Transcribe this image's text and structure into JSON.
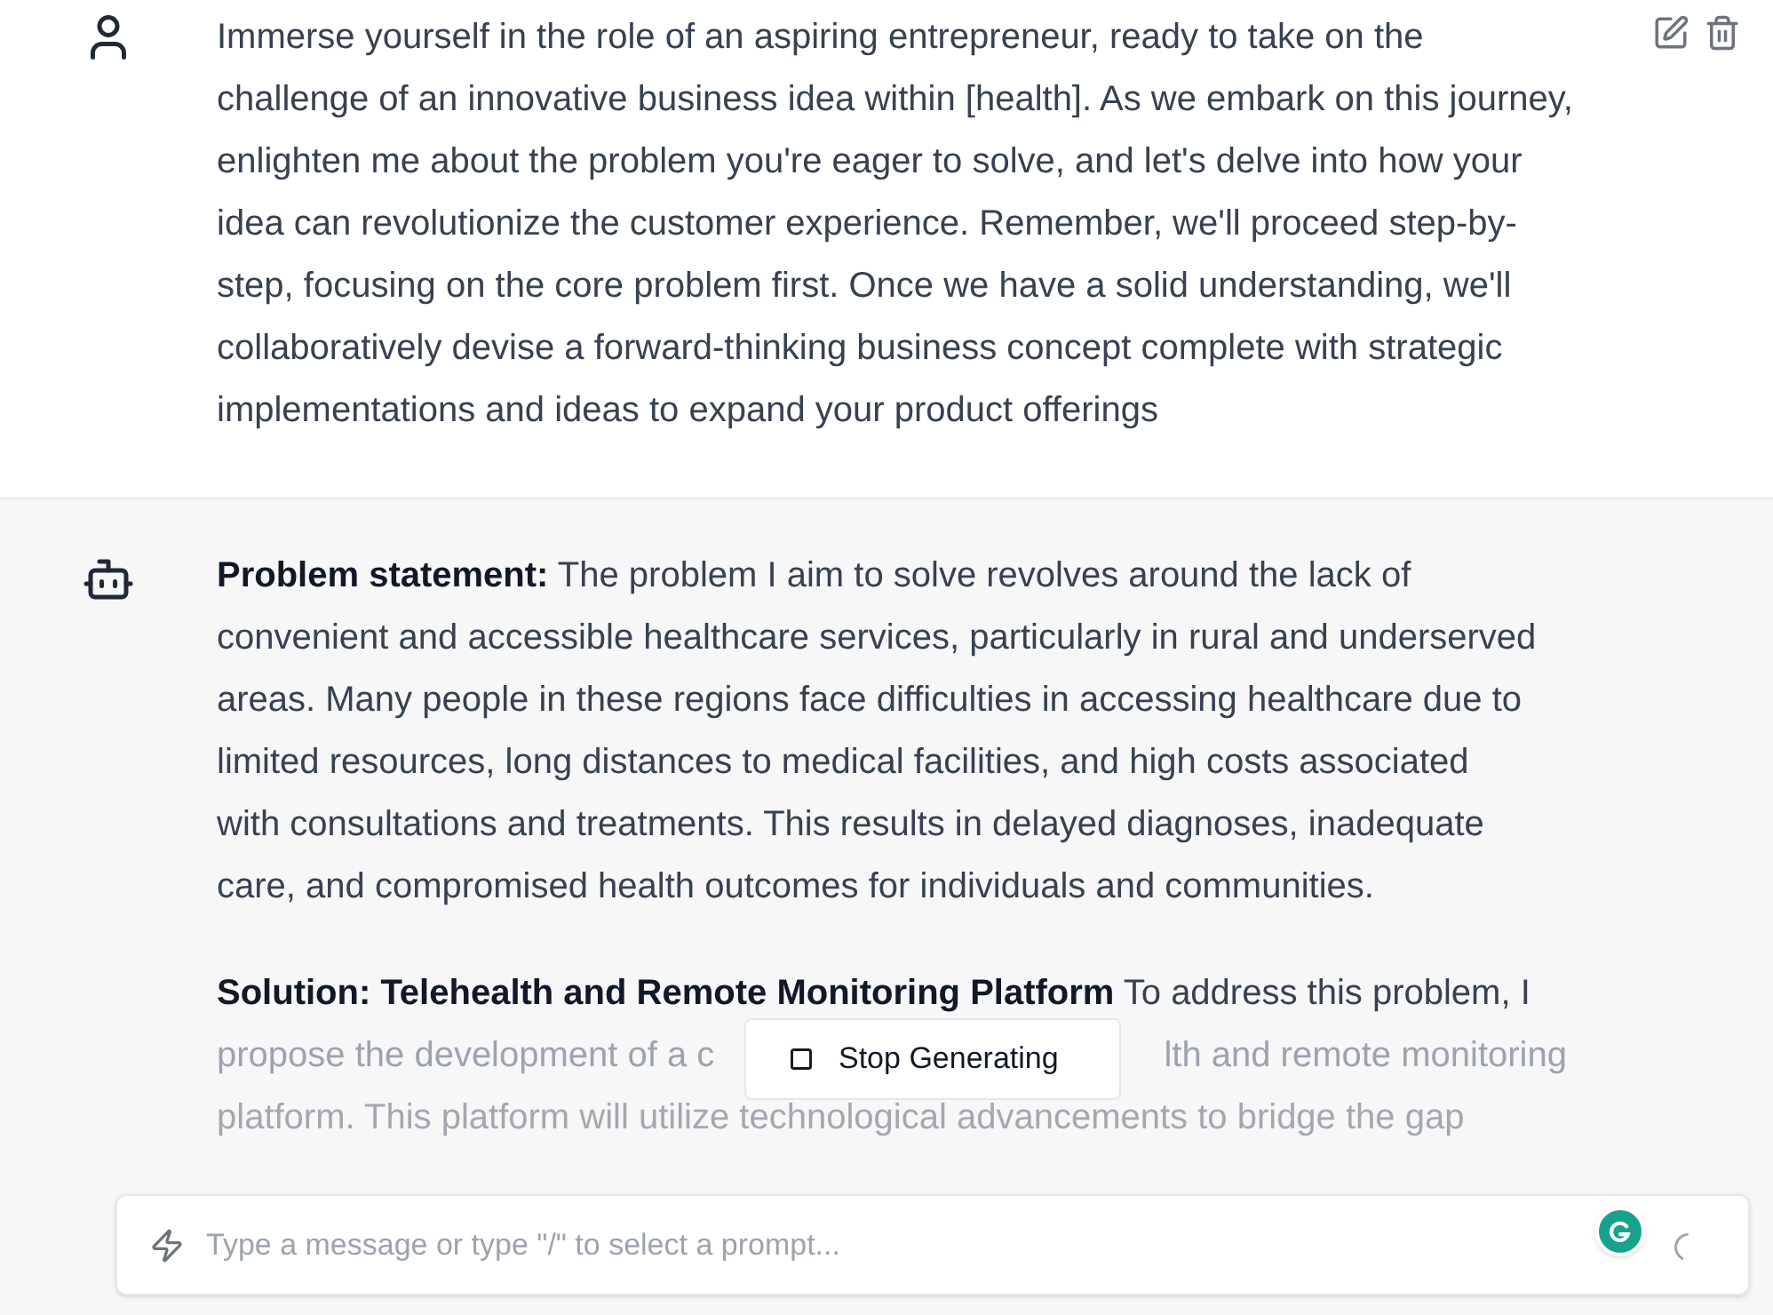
{
  "messages": [
    {
      "kind": "user",
      "text": "Immerse yourself in the role of an aspiring entrepreneur, ready to take on the challenge of an innovative business idea within [health]. As we embark on this journey, enlighten me about the problem you're eager to solve, and let's delve into how your idea can revolutionize the customer experience. Remember, we'll proceed step-by-step, focusing on the core problem first. Once we have a solid understanding, we'll collaboratively devise a forward-thinking business concept complete with strategic implementations and ideas to expand your product offerings"
    },
    {
      "kind": "bot",
      "paragraphs": [
        "**Problem statement:** The problem I aim to solve revolves around the lack of convenient and accessible healthcare services, particularly in rural and underserved areas. Many people in these regions face difficulties in accessing healthcare due to limited resources, long distances to medical facilities, and high costs associated with consultations and treatments. This results in delayed diagnoses, inadequate care, and compromised health outcomes for individuals and communities."
      ],
      "partial": {
        "first_line": "**Solution: Telehealth and Remote Monitoring Platform** To address this problem, I",
        "second_line_left": "propose the development of a c",
        "second_line_right": "lth and remote monitoring",
        "third_line": "platform. This platform will utilize technological advancements to bridge the gap"
      }
    }
  ],
  "stop_button": {
    "label": "Stop Generating"
  },
  "composer": {
    "placeholder": "Type a message or type \"/\" to select a prompt..."
  }
}
